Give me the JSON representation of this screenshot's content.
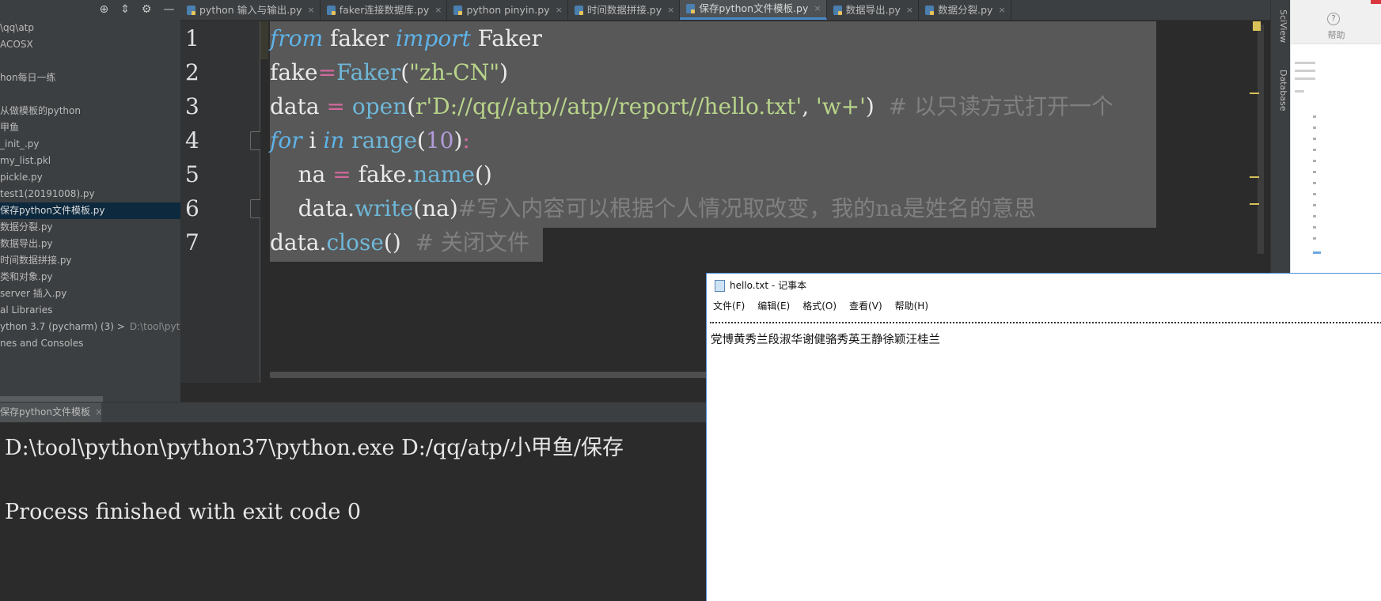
{
  "sidebar": {
    "items": [
      "\\qq\\atp",
      "ACOSX",
      "",
      "hon每日一练",
      "",
      "从做模板的python",
      "甲鱼",
      "_init_.py",
      "my_list.pkl",
      "pickle.py",
      "test1(20191008).py",
      "保存python文件模板.py",
      "数据分裂.py",
      "数据导出.py",
      "时间数据拼接.py",
      "类和对象.py",
      "server 插入.py",
      "al Libraries",
      "ython 3.7 (pycharm) (3) >",
      "nes and Consoles"
    ],
    "sdk_path_hint": "D:\\tool\\pytho",
    "toolbar": [
      "target-icon",
      "collapse-icon",
      "gear-icon",
      "minimize-icon"
    ]
  },
  "tabs": [
    {
      "label": "python 输入与输出.py",
      "active": false
    },
    {
      "label": "faker连接数据库.py",
      "active": false
    },
    {
      "label": "python pinyin.py",
      "active": false
    },
    {
      "label": "时间数据拼接.py",
      "active": false
    },
    {
      "label": "保存python文件模板.py",
      "active": true
    },
    {
      "label": "数据导出.py",
      "active": false
    },
    {
      "label": "数据分裂.py",
      "active": false
    }
  ],
  "editor": {
    "line_numbers": [
      "1",
      "2",
      "3",
      "4",
      "5",
      "6",
      "7"
    ],
    "lines": [
      {
        "parts": [
          [
            "kw",
            "from"
          ],
          [
            "t",
            " faker "
          ],
          [
            "kw",
            "import"
          ],
          [
            "t",
            " Faker"
          ]
        ]
      },
      {
        "parts": [
          [
            "t",
            "fake"
          ],
          [
            "op",
            "="
          ],
          [
            "fn",
            "Faker"
          ],
          [
            "t",
            "("
          ],
          [
            "str",
            "\"zh-CN\""
          ],
          [
            "t",
            ")"
          ]
        ]
      },
      {
        "parts": [
          [
            "t",
            "data "
          ],
          [
            "op",
            "="
          ],
          [
            "t",
            " "
          ],
          [
            "fn",
            "open"
          ],
          [
            "t",
            "("
          ],
          [
            "str",
            "r'D://qq//atp//atp//report//hello.txt'"
          ],
          [
            "t",
            ", "
          ],
          [
            "str",
            "'w+'"
          ],
          [
            "t",
            ")  "
          ],
          [
            "cmt",
            "# 以只读方式打开一个"
          ]
        ]
      },
      {
        "parts": [
          [
            "kw",
            "for"
          ],
          [
            "t",
            " i "
          ],
          [
            "kw",
            "in"
          ],
          [
            "t",
            " "
          ],
          [
            "fn",
            "range"
          ],
          [
            "t",
            "("
          ],
          [
            "num",
            "10"
          ],
          [
            "t",
            ")"
          ],
          [
            "op",
            ":"
          ]
        ]
      },
      {
        "parts": [
          [
            "t",
            "    na "
          ],
          [
            "op",
            "="
          ],
          [
            "t",
            " fake."
          ],
          [
            "fn",
            "name"
          ],
          [
            "t",
            "()"
          ]
        ]
      },
      {
        "parts": [
          [
            "t",
            "    data."
          ],
          [
            "fn",
            "write"
          ],
          [
            "t",
            "(na)"
          ],
          [
            "cmt",
            "#写入内容可以根据个人情况取改变，我的na是姓名的意思"
          ]
        ]
      },
      {
        "parts": [
          [
            "t",
            "data."
          ],
          [
            "fn",
            "close"
          ],
          [
            "t",
            "()  "
          ],
          [
            "cmt",
            "# 关闭文件"
          ]
        ]
      }
    ]
  },
  "right_strip": {
    "sciview": "SciView",
    "database": "Database"
  },
  "background_app": {
    "help_label": "帮助"
  },
  "run": {
    "tab_label": "保存python文件模板",
    "console": [
      "D:\\tool\\python\\python37\\python.exe D:/qq/atp/小甲鱼/保存",
      "",
      "Process finished with exit code 0"
    ]
  },
  "notepad": {
    "title": "hello.txt - 记事本",
    "menu": [
      "文件(F)",
      "编辑(E)",
      "格式(O)",
      "查看(V)",
      "帮助(H)"
    ],
    "content": "党博黄秀兰段淑华谢健骆秀英王静徐颖汪桂兰"
  }
}
